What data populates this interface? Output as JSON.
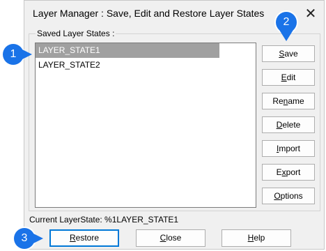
{
  "dialog": {
    "title": "Layer Manager : Save, Edit and Restore Layer States",
    "close_glyph": "✕"
  },
  "group": {
    "label": "Saved Layer States :",
    "items": [
      {
        "label": "LAYER_STATE1",
        "selected": true
      },
      {
        "label": "LAYER_STATE2",
        "selected": false
      }
    ]
  },
  "side_buttons": [
    {
      "label": "Save",
      "mnemonic_index": 0
    },
    {
      "label": "Edit",
      "mnemonic_index": 0
    },
    {
      "label": "Rename",
      "mnemonic_index": 2
    },
    {
      "label": "Delete",
      "mnemonic_index": 0
    },
    {
      "label": "Import",
      "mnemonic_index": 0
    },
    {
      "label": "Export",
      "mnemonic_index": 1
    },
    {
      "label": "Options",
      "mnemonic_index": 0
    }
  ],
  "status": {
    "text": "Current LayerState: %1LAYER_STATE1"
  },
  "bottom_buttons": [
    {
      "label": "Restore",
      "mnemonic_index": 0
    },
    {
      "label": "Close",
      "mnemonic_index": 0
    },
    {
      "label": "Help",
      "mnemonic_index": 0
    }
  ],
  "callouts": [
    "1",
    "2",
    "3"
  ],
  "colors": {
    "callout": "#1a73e8",
    "selection": "#a0a0a0",
    "focus_border": "#0078d7"
  }
}
